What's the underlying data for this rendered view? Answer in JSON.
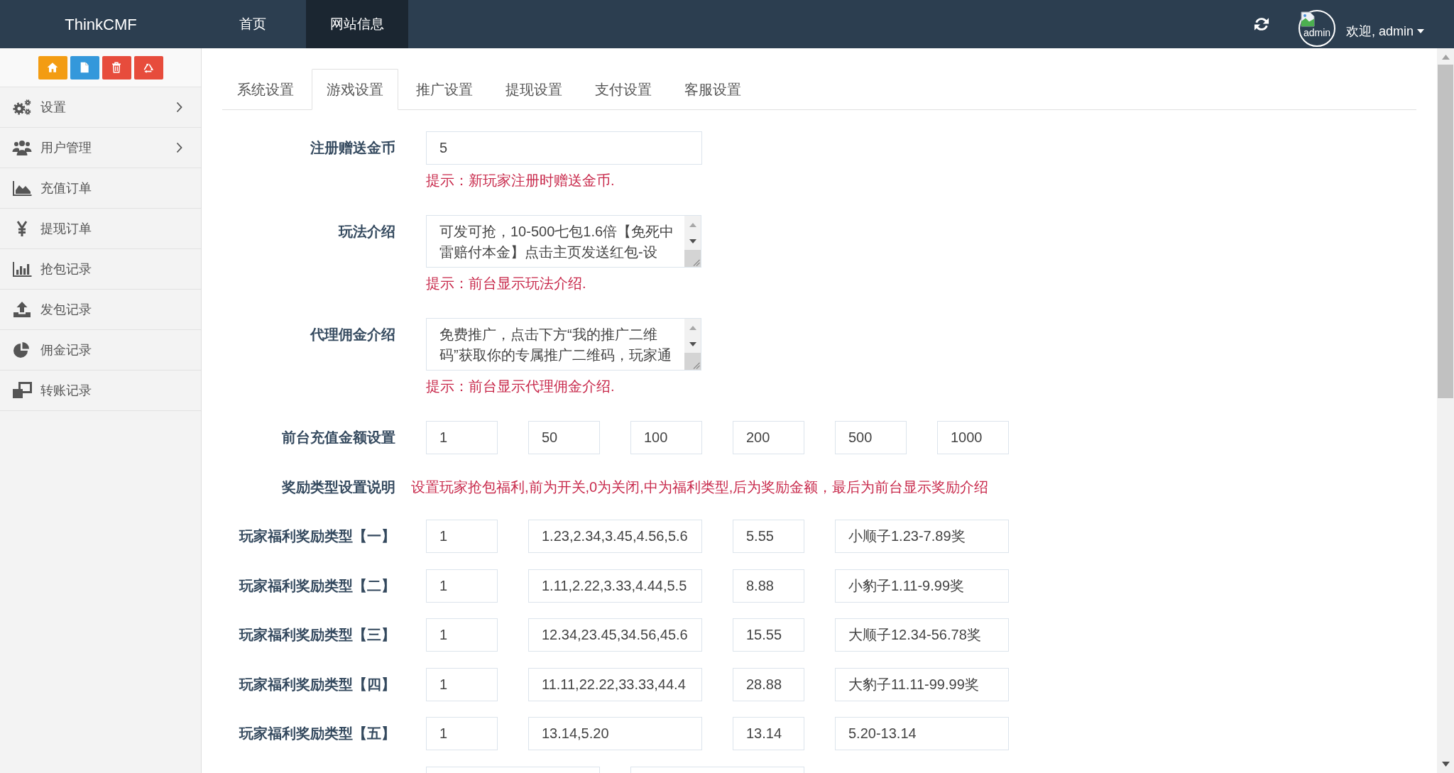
{
  "navbar": {
    "brand": "ThinkCMF",
    "items": [
      {
        "label": "首页",
        "selected": false
      },
      {
        "label": "网站信息",
        "selected": true
      }
    ],
    "avatar": {
      "alt": "admin"
    },
    "user_menu": "欢迎, admin"
  },
  "sidebar": {
    "shortcuts": [
      {
        "color": "#f39c12"
      },
      {
        "color": "#3498db"
      },
      {
        "color": "#e74c3c"
      },
      {
        "color": "#e74c3c"
      }
    ],
    "items": [
      {
        "label": "设置",
        "has_submenu": true
      },
      {
        "label": "用户管理",
        "has_submenu": true
      },
      {
        "label": "充值订单",
        "has_submenu": false
      },
      {
        "label": "提现订单",
        "has_submenu": false
      },
      {
        "label": "抢包记录",
        "has_submenu": false
      },
      {
        "label": "发包记录",
        "has_submenu": false
      },
      {
        "label": "佣金记录",
        "has_submenu": false
      },
      {
        "label": "转账记录",
        "has_submenu": false
      }
    ]
  },
  "tabs": [
    {
      "label": "系统设置",
      "selected": false
    },
    {
      "label": "游戏设置",
      "selected": true
    },
    {
      "label": "推广设置",
      "selected": false
    },
    {
      "label": "提现设置",
      "selected": false
    },
    {
      "label": "支付设置",
      "selected": false
    },
    {
      "label": "客服设置",
      "selected": false
    }
  ],
  "form": {
    "rows": [
      {
        "kind": "input",
        "label": "注册赠送金币",
        "fields": [
          {
            "kind": "long",
            "value": "5"
          }
        ],
        "hint": "提示：新玩家注册时赠送金币."
      },
      {
        "kind": "textarea",
        "label": "玩法介绍",
        "value": "可发可抢，10-500七包1.6倍【免死中雷赔付本金】点击主页发送红包-设",
        "hint": "提示：前台显示玩法介绍."
      },
      {
        "kind": "textarea",
        "label": "代理佣金介绍",
        "value": "免费推广，点击下方“我的推广二维码”获取你的专属推广二维码，玩家通",
        "hint": "提示：前台显示代理佣金介绍."
      },
      {
        "kind": "input",
        "label": "前台充值金额设置",
        "fields": [
          {
            "kind": "short",
            "value": "1"
          },
          {
            "kind": "short",
            "value": "50"
          },
          {
            "kind": "short",
            "value": "100"
          },
          {
            "kind": "short",
            "value": "200"
          },
          {
            "kind": "short",
            "value": "500"
          },
          {
            "kind": "short",
            "value": "1000"
          }
        ]
      },
      {
        "kind": "note",
        "label": "奖励类型设置说明",
        "text": "设置玩家抢包福利,前为开关,0为关闭,中为福利类型,后为奖励金额，最后为前台显示奖励介绍"
      },
      {
        "kind": "input",
        "label": "玩家福利奖励类型【一】",
        "fields": [
          {
            "kind": "short",
            "value": "1"
          },
          {
            "kind": "wide",
            "value": "1.23,2.34,3.45,4.56,5.6"
          },
          {
            "kind": "short",
            "value": "5.55"
          },
          {
            "kind": "wide",
            "value": "小顺子1.23-7.89奖"
          }
        ]
      },
      {
        "kind": "input",
        "label": "玩家福利奖励类型【二】",
        "fields": [
          {
            "kind": "short",
            "value": "1"
          },
          {
            "kind": "wide",
            "value": "1.11,2.22,3.33,4.44,5.5"
          },
          {
            "kind": "short",
            "value": "8.88"
          },
          {
            "kind": "wide",
            "value": "小豹子1.11-9.99奖"
          }
        ]
      },
      {
        "kind": "input",
        "label": "玩家福利奖励类型【三】",
        "fields": [
          {
            "kind": "short",
            "value": "1"
          },
          {
            "kind": "wide",
            "value": "12.34,23.45,34.56,45.6"
          },
          {
            "kind": "short",
            "value": "15.55"
          },
          {
            "kind": "wide",
            "value": "大顺子12.34-56.78奖"
          }
        ]
      },
      {
        "kind": "input",
        "label": "玩家福利奖励类型【四】",
        "fields": [
          {
            "kind": "short",
            "value": "1"
          },
          {
            "kind": "wide",
            "value": "11.11,22.22,33.33,44.4"
          },
          {
            "kind": "short",
            "value": "28.88"
          },
          {
            "kind": "wide",
            "value": "大豹子11.11-99.99奖"
          }
        ]
      },
      {
        "kind": "input",
        "label": "玩家福利奖励类型【五】",
        "fields": [
          {
            "kind": "short",
            "value": "1"
          },
          {
            "kind": "wide",
            "value": "13.14,5.20"
          },
          {
            "kind": "short",
            "value": "13.14"
          },
          {
            "kind": "wide",
            "value": "5.20-13.14"
          }
        ]
      },
      {
        "kind": "input",
        "fields": [
          {
            "kind": "wide"
          },
          {
            "kind": "wide"
          }
        ]
      }
    ]
  }
}
